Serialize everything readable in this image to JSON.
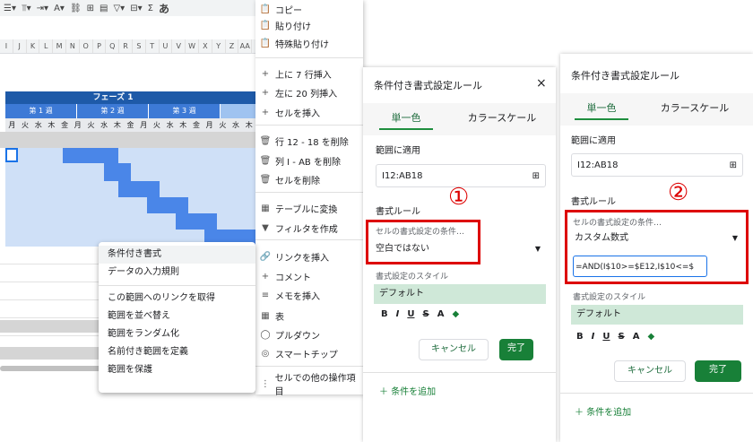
{
  "toolbar": {
    "icons": [
      "align-icon",
      "valign-icon",
      "wrap-icon",
      "rotate-icon",
      "text-color-icon",
      "link-icon",
      "comment-icon",
      "chart-icon",
      "filter-icon",
      "filter-views-icon",
      "function-icon",
      "input-tools-icon"
    ],
    "sigma": "Σ",
    "input_glyph": "あ"
  },
  "columns": [
    "I",
    "J",
    "K",
    "L",
    "M",
    "N",
    "O",
    "P",
    "Q",
    "R",
    "S",
    "T",
    "U",
    "V",
    "W",
    "X",
    "Y",
    "Z",
    "AA"
  ],
  "gantt": {
    "phase": "フェーズ 1",
    "weeks": [
      "第 1 週",
      "第 2 週",
      "第 3 週"
    ],
    "days": [
      "月",
      "火",
      "水",
      "木",
      "金",
      "月",
      "火",
      "水",
      "木",
      "金",
      "月",
      "火",
      "水",
      "木",
      "金",
      "月",
      "火",
      "水",
      "木"
    ]
  },
  "context_menu": {
    "items": [
      "条件付き書式",
      "データの入力規則",
      "この範囲へのリンクを取得",
      "範囲を並べ替え",
      "範囲をランダム化",
      "名前付き範囲を定義",
      "範囲を保護"
    ]
  },
  "main_menu": {
    "items": [
      {
        "icon": "📋",
        "label": "コピー"
      },
      {
        "icon": "📋",
        "label": "貼り付け"
      },
      {
        "icon": "📋",
        "label": "特殊貼り付け"
      },
      {
        "icon": "+",
        "label": "上に 7 行挿入"
      },
      {
        "icon": "+",
        "label": "左に 20 列挿入"
      },
      {
        "icon": "+",
        "label": "セルを挿入"
      },
      {
        "icon": "🗑",
        "label": "行 12 - 18 を削除"
      },
      {
        "icon": "🗑",
        "label": "列 I - AB を削除"
      },
      {
        "icon": "🗑",
        "label": "セルを削除"
      },
      {
        "icon": "▦",
        "label": "テーブルに変換"
      },
      {
        "icon": "▼",
        "label": "フィルタを作成"
      },
      {
        "icon": "🔗",
        "label": "リンクを挿入"
      },
      {
        "icon": "+",
        "label": "コメント"
      },
      {
        "icon": "≡",
        "label": "メモを挿入"
      },
      {
        "icon": "▦",
        "label": "表"
      },
      {
        "icon": "◯",
        "label": "プルダウン"
      },
      {
        "icon": "◎",
        "label": "スマートチップ"
      },
      {
        "icon": "⋮",
        "label": "セルでの他の操作項目"
      }
    ]
  },
  "panel1": {
    "title": "条件付き書式設定ルール",
    "close": "×",
    "tab_single": "単一色",
    "tab_scale": "カラースケール",
    "range_label": "範囲に適用",
    "range_value": "I12:AB18",
    "rules_label": "書式ルール",
    "condition_label": "セルの書式設定の条件…",
    "condition_value": "空白ではない",
    "style_label": "書式設定のスタイル",
    "style_value": "デフォルト",
    "cancel": "キャンセル",
    "done": "完了",
    "add_rule": "条件を追加",
    "marker": "①"
  },
  "panel2": {
    "title": "条件付き書式設定ルール",
    "tab_single": "単一色",
    "tab_scale": "カラースケール",
    "range_label": "範囲に適用",
    "range_value": "I12:AB18",
    "rules_label": "書式ルール",
    "condition_label": "セルの書式設定の条件…",
    "condition_value": "カスタム数式",
    "formula_value": "=AND(I$10>=$E12,I$10<=$",
    "style_label": "書式設定のスタイル",
    "style_value": "デフォルト",
    "cancel": "キャンセル",
    "done": "完了",
    "add_rule": "条件を追加",
    "marker": "②"
  },
  "format_buttons": [
    "B",
    "I",
    "U",
    "S",
    "A",
    "◆"
  ]
}
